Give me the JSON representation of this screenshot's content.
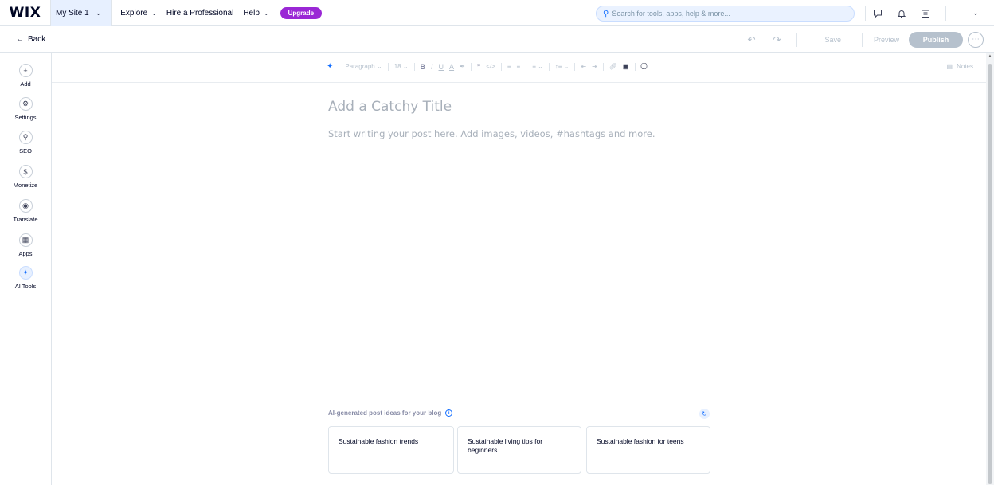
{
  "topbar": {
    "logo": "WIX",
    "site_name": "My Site 1",
    "nav": [
      {
        "label": "Explore"
      },
      {
        "label": "Hire a Professional"
      },
      {
        "label": "Help"
      }
    ],
    "upgrade_label": "Upgrade",
    "search_placeholder": "Search for tools, apps, help & more...",
    "icons": [
      "chat-icon",
      "bell-icon",
      "calendar-icon",
      "chevron-down-icon"
    ]
  },
  "editor_bar": {
    "back_label": "Back",
    "save_label": "Save",
    "preview_label": "Preview",
    "publish_label": "Publish"
  },
  "sidebar": {
    "items": [
      {
        "label": "Add",
        "icon": "plus-icon"
      },
      {
        "label": "Settings",
        "icon": "gear-icon"
      },
      {
        "label": "SEO",
        "icon": "search-icon"
      },
      {
        "label": "Monetize",
        "icon": "dollar-icon"
      },
      {
        "label": "Translate",
        "icon": "globe-icon"
      },
      {
        "label": "Apps",
        "icon": "apps-icon"
      },
      {
        "label": "AI Tools",
        "icon": "sparkle-icon"
      }
    ]
  },
  "toolbar": {
    "paragraph_label": "Paragraph",
    "font_size": "18",
    "notes_label": "Notes"
  },
  "post": {
    "title_placeholder": "Add a Catchy Title",
    "body_placeholder": "Start writing your post here. Add images, videos, #hashtags and more."
  },
  "ideas": {
    "heading": "AI-generated post ideas for your blog",
    "cards": [
      {
        "text": "Sustainable fashion trends"
      },
      {
        "text": "Sustainable living tips for beginners"
      },
      {
        "text": "Sustainable fashion for teens"
      }
    ]
  },
  "colors": {
    "accent": "#116dff",
    "upgrade": "#9a27d5",
    "disabled": "#b6c1cd"
  }
}
